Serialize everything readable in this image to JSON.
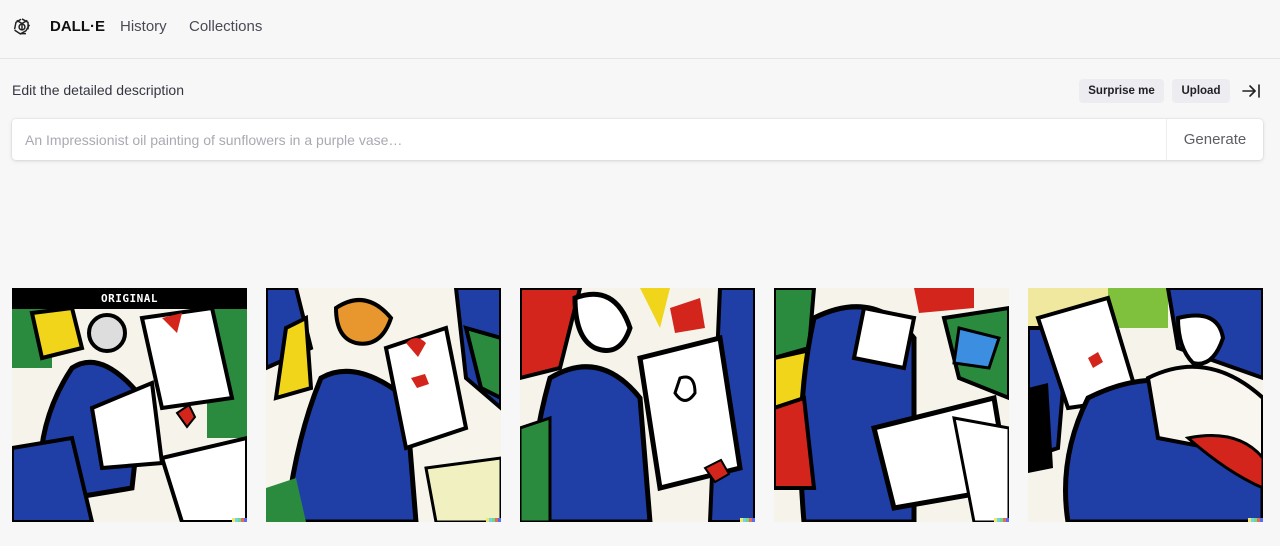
{
  "nav": {
    "brand": "DALL·E",
    "items": [
      "History",
      "Collections"
    ]
  },
  "editor": {
    "heading": "Edit the detailed description",
    "surprise_label": "Surprise me",
    "upload_label": "Upload",
    "prompt_placeholder": "An Impressionist oil painting of sunflowers in a purple vase…",
    "prompt_value": "",
    "generate_label": "Generate"
  },
  "results": {
    "original_badge": "ORIGINAL",
    "images": [
      {
        "label": "original-variation"
      },
      {
        "label": "variation-1"
      },
      {
        "label": "variation-2"
      },
      {
        "label": "variation-3"
      },
      {
        "label": "variation-4"
      }
    ]
  },
  "colors": {
    "signature": [
      "#f5e663",
      "#6fd4e8",
      "#6adb8a",
      "#e86a5b",
      "#5a6cf0"
    ],
    "palette_blue": "#1f3fa6",
    "palette_red": "#d4251c",
    "palette_yellow": "#f1d51a",
    "palette_green": "#2a8a3e"
  },
  "icons": {
    "logo": "openai-logo-icon",
    "collapse": "collapse-panel-icon"
  }
}
